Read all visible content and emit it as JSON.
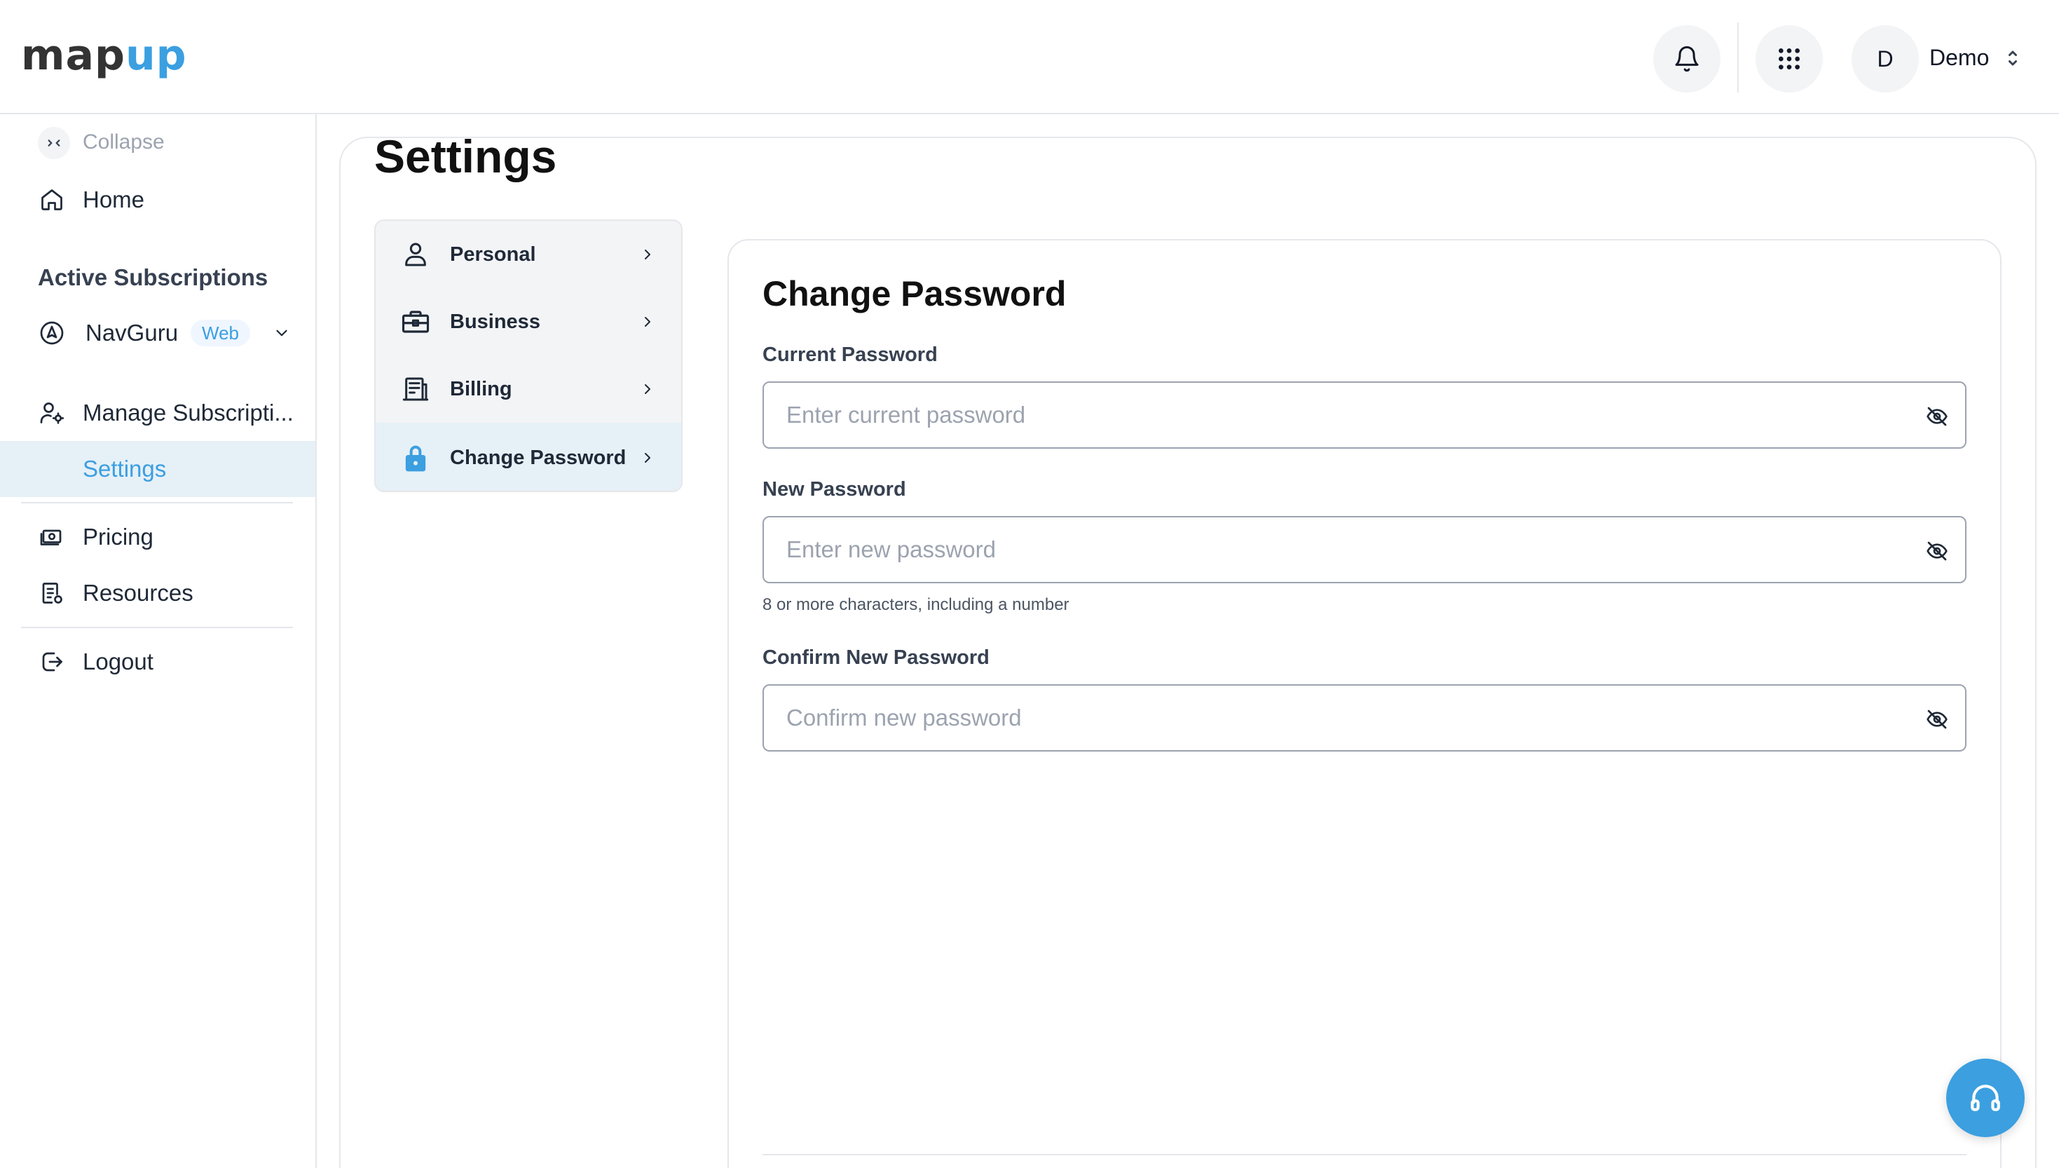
{
  "header": {
    "logo_left": "map",
    "logo_right": "up",
    "user_initial": "D",
    "user_name": "Demo"
  },
  "sidebar": {
    "collapse_label": "Collapse",
    "home_label": "Home",
    "section_heading": "Active Subscriptions",
    "subscription": {
      "label": "NavGuru",
      "badge": "Web"
    },
    "manage_label": "Manage Subscripti...",
    "settings_label": "Settings",
    "pricing_label": "Pricing",
    "resources_label": "Resources",
    "logout_label": "Logout"
  },
  "page": {
    "title": "Settings"
  },
  "settings_nav": {
    "items": [
      {
        "label": "Personal",
        "icon": "user-icon"
      },
      {
        "label": "Business",
        "icon": "briefcase-icon"
      },
      {
        "label": "Billing",
        "icon": "receipt-icon"
      },
      {
        "label": "Change Password",
        "icon": "lock-icon",
        "active": true
      }
    ]
  },
  "form": {
    "title": "Change Password",
    "current": {
      "label": "Current Password",
      "placeholder": "Enter current password",
      "value": ""
    },
    "new": {
      "label": "New Password",
      "placeholder": "Enter new password",
      "value": "",
      "hint": "8 or more characters, including a number"
    },
    "confirm": {
      "label": "Confirm New Password",
      "placeholder": "Confirm new password",
      "value": ""
    }
  },
  "colors": {
    "accent": "#3b9fe0",
    "active_bg": "#e6f0f7",
    "border": "#e5e7eb"
  }
}
